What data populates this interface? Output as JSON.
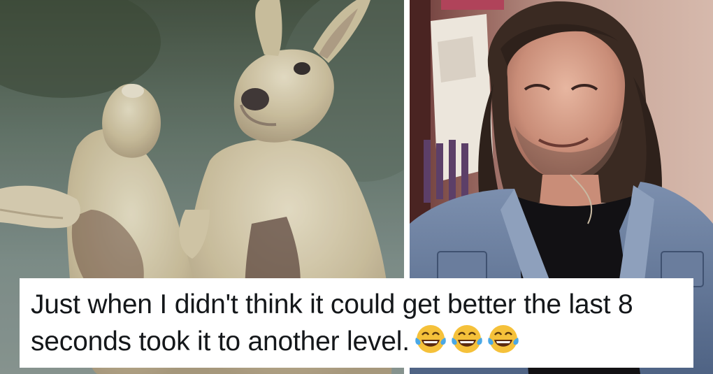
{
  "caption": {
    "text": "Just when I didn't think it could get better the last 8 seconds took it to another level.",
    "emoji_count": 3,
    "emoji_name": "face-with-tears-of-joy"
  },
  "left_image": {
    "subject": "two kangaroos boxing"
  },
  "right_image": {
    "subject": "smiling long-haired man in denim jacket"
  },
  "colors": {
    "caption_background": "#ffffff",
    "caption_text": "#14171a",
    "emoji_face": "#f5c13a"
  }
}
